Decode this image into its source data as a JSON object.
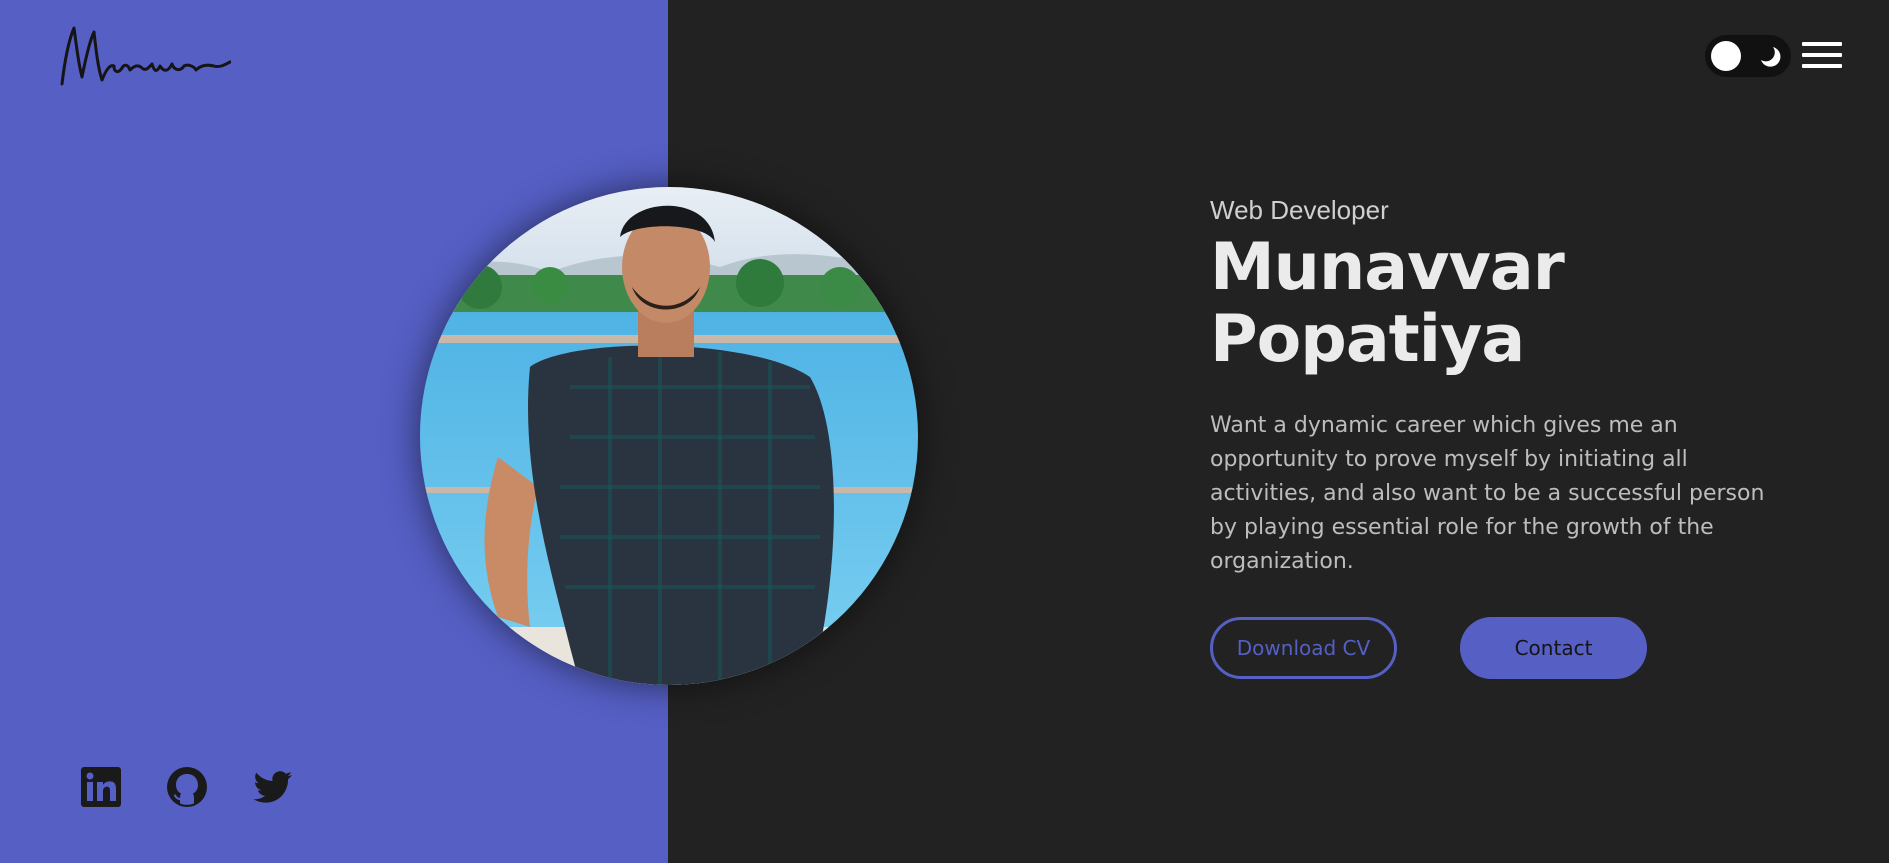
{
  "logo": {
    "text": "Munavvar",
    "icon": "signature-logo"
  },
  "header": {
    "theme_toggle": {
      "icon_light": "sun-knob-icon",
      "icon_dark": "moon-icon",
      "state": "dark"
    },
    "menu": {
      "icon": "hamburger-menu-icon"
    }
  },
  "hero": {
    "subtitle": "Web Developer",
    "name_line1": "Munavvar",
    "name_line2": "Popatiya",
    "description": "Want a dynamic career which gives me an opportunity to prove myself by initiating all activities, and also want to be a successful person by playing essential role for the growth of the organization.",
    "buttons": {
      "download": "Download CV",
      "contact": "Contact"
    }
  },
  "socials": [
    {
      "icon": "linkedin-icon"
    },
    {
      "icon": "github-icon"
    },
    {
      "icon": "twitter-icon"
    }
  ],
  "colors": {
    "accent": "#555FC4",
    "background": "#222222",
    "text": "#EBEBEB",
    "muted": "#BDBDBD"
  }
}
